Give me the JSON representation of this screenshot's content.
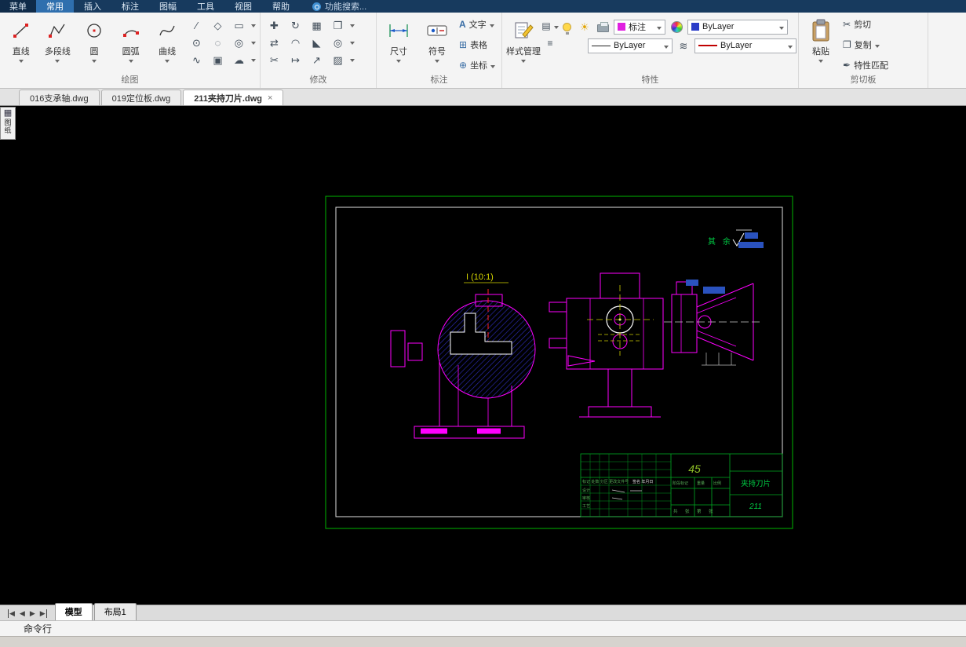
{
  "colors": {
    "titlebar_bg": "#173a5e",
    "active_tab_bg": "#2f6fae",
    "canvas_bg": "#000000",
    "frame_green": "#00b400",
    "line_magenta": "#ff00ff",
    "hatch_blue": "#2b2bb4",
    "note_green": "#00cc44",
    "highlight_blue": "#2a52be"
  },
  "menubar": {
    "menu_button": "菜单",
    "tabs": [
      {
        "label": "常用"
      },
      {
        "label": "插入"
      },
      {
        "label": "标注"
      },
      {
        "label": "图幅"
      },
      {
        "label": "工具"
      },
      {
        "label": "视图"
      },
      {
        "label": "帮助"
      }
    ],
    "search_placeholder": "功能搜索..."
  },
  "ribbon": {
    "draw": {
      "label": "绘图",
      "buttons": [
        "直线",
        "多段线",
        "圆",
        "圆弧",
        "曲线"
      ]
    },
    "modify": {
      "label": "修改"
    },
    "annotate": {
      "label": "标注",
      "dim": "尺寸",
      "symbol": "符号",
      "text": "文字",
      "table": "表格",
      "coord": "坐标"
    },
    "properties": {
      "label": "特性",
      "style_manager": "样式管理",
      "dim_style": "标注",
      "color_value": "ByLayer",
      "linetype_value": "ByLayer",
      "lineweight_value": "ByLayer"
    },
    "clipboard": {
      "label": "剪切板",
      "paste": "粘贴",
      "cut": "剪切",
      "copy": "复制",
      "match": "特性匹配"
    }
  },
  "doc_tabs": [
    {
      "label": "016支承轴.dwg"
    },
    {
      "label": "019定位板.dwg"
    },
    {
      "label": "211夹持刀片.dwg"
    }
  ],
  "palette_tab": "图纸",
  "drawing": {
    "detail_label": "I  (10:1)",
    "surface_note": "其 余",
    "title_block": {
      "material": "45",
      "part_name": "夹持刀片",
      "part_number": "211",
      "header_left": "标记 处数 分区 更改文件号",
      "header_right": "签名 年月日",
      "rows": [
        "设计",
        "审核",
        "工艺"
      ],
      "stage": "阶段标记",
      "weight": "重量",
      "scale": "比例",
      "sheets": "共 张 第 张"
    }
  },
  "layout_bar": {
    "model": "模型",
    "layout1": "布局1"
  },
  "command_line": "命令行",
  "glyphs": {
    "draw_grid": [
      "∕",
      "◇",
      "▭",
      "⊙",
      "◌",
      "◎",
      "∿",
      "▣",
      "☁"
    ],
    "modify_grid": [
      "✚",
      "↻",
      "▦",
      "❐",
      "⇄",
      "◠",
      "◣",
      "◎",
      "✂",
      "↦",
      "↗",
      "▨"
    ],
    "text_icon": "A",
    "table_icon": "⊞",
    "coord_icon": "⊕",
    "sheet_icon": "▤",
    "menu_lines_icon": "≡",
    "linetype_lines_icon": "≋",
    "sun_icon": "☀",
    "cut_icon": "✂",
    "copy_icon": "❐",
    "match_icon": "✒",
    "palette_icon": "▦",
    "nav_first": "◀",
    "nav_prev": "◀",
    "nav_next": "▶",
    "nav_last": "▶",
    "close": "×"
  }
}
